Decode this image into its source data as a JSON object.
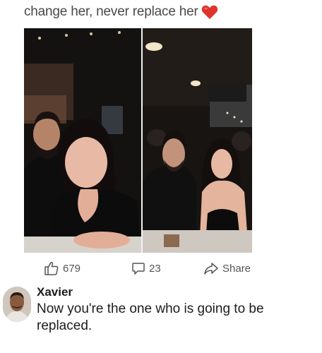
{
  "post": {
    "caption": "change her, never replace her",
    "caption_emoji": "heart-icon",
    "accent_red": "#e0332b"
  },
  "actions": {
    "like_count": "679",
    "comment_count": "23",
    "share_label": "Share"
  },
  "comment": {
    "author": "Xavier",
    "text": "Now you're the one who is going to be replaced."
  }
}
